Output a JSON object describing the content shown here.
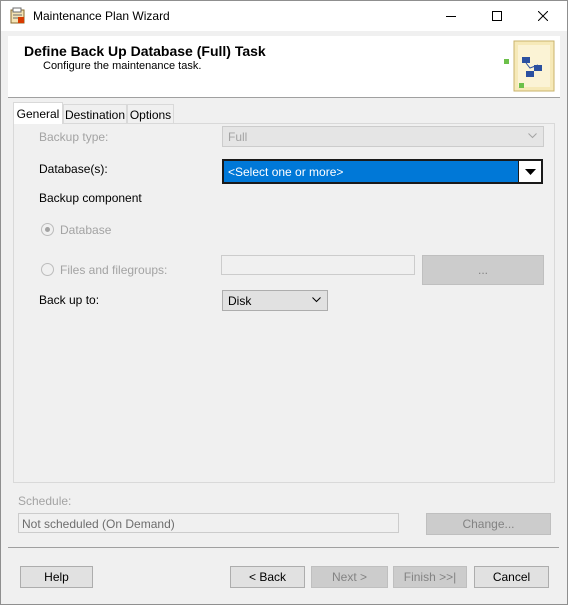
{
  "window": {
    "title": "Maintenance Plan Wizard"
  },
  "header": {
    "title": "Define Back Up Database (Full) Task",
    "subtitle": "Configure the maintenance task."
  },
  "tabs": [
    {
      "label": "General",
      "active": true
    },
    {
      "label": "Destination",
      "active": false
    },
    {
      "label": "Options",
      "active": false
    }
  ],
  "general": {
    "backup_type": {
      "label": "Backup type:",
      "value": "Full",
      "enabled": false
    },
    "databases": {
      "label": "Database(s):",
      "value": "<Select one or more>",
      "enabled": true
    },
    "backup_component": {
      "label": "Backup component",
      "options": [
        {
          "label": "Database",
          "selected": true,
          "enabled": false
        },
        {
          "label": "Files and filegroups:",
          "selected": false,
          "enabled": false
        }
      ],
      "files_value": "",
      "browse_label": "..."
    },
    "back_up_to": {
      "label": "Back up to:",
      "value": "Disk"
    }
  },
  "schedule": {
    "label": "Schedule:",
    "value": "Not scheduled (On Demand)",
    "change_label": "Change..."
  },
  "footer": {
    "help_label": "Help",
    "back_label": "< Back",
    "next_label": "Next >",
    "finish_label": "Finish >>|",
    "cancel_label": "Cancel"
  },
  "colors": {
    "selection": "#0078d7",
    "disabled_text": "#a3a3a3",
    "dialog_bg": "#f0f0f0"
  }
}
